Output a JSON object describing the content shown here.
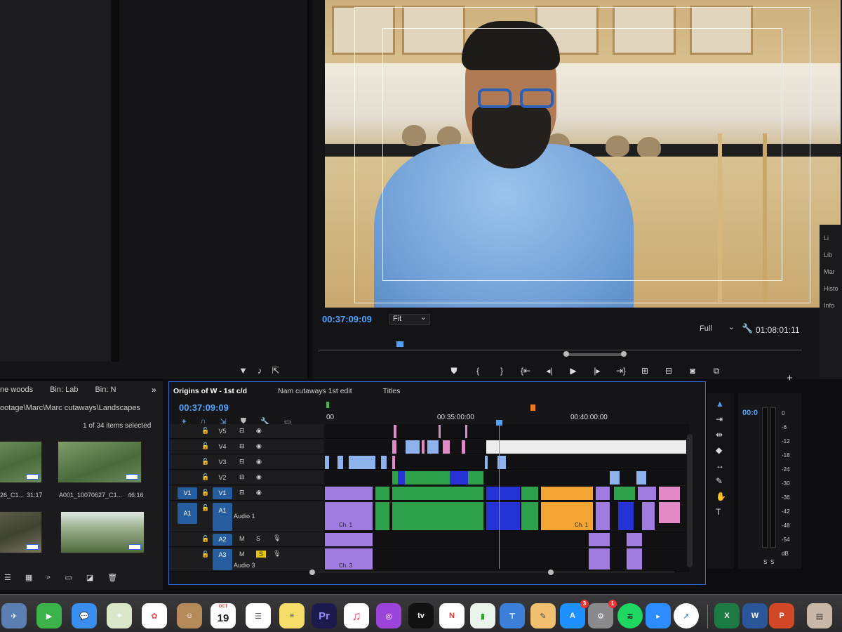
{
  "program": {
    "timecode": "00:37:09:09",
    "zoom": "Fit",
    "resolution": "Full",
    "duration": "01:08:01:11"
  },
  "right_strip": [
    "Li",
    "Lib",
    "Mar",
    "Histo",
    "Info"
  ],
  "project": {
    "tabs": [
      "ne woods",
      "Bin: Lab",
      "Bin: N"
    ],
    "more": "»",
    "path": "ootage\\Marc\\Marc cutaways\\Landscapes",
    "count": "1 of 34 items selected",
    "thumbs": [
      {
        "label": "26_C1...",
        "duration": "31:17"
      },
      {
        "label": "A001_10070627_C1...",
        "duration": "46:16"
      },
      {
        "label": "",
        "duration": ""
      },
      {
        "label": "",
        "duration": ""
      }
    ]
  },
  "timeline": {
    "tabs": [
      "Origins of W - 1st c/d",
      "Nam cutaways 1st edit",
      "Titles"
    ],
    "timecode": "00:37:09:09",
    "ruler": [
      "00",
      "00:35:00:00",
      "00:40:00:00"
    ],
    "tracks": [
      {
        "name": "V5",
        "source": ""
      },
      {
        "name": "V4",
        "source": ""
      },
      {
        "name": "V3",
        "source": ""
      },
      {
        "name": "V2",
        "source": ""
      },
      {
        "name": "V1",
        "source": "V1"
      },
      {
        "name": "A1",
        "source": "A1",
        "label": "Audio 1"
      },
      {
        "name": "A2",
        "source": "",
        "mute": "M",
        "solo": "S"
      },
      {
        "name": "A3",
        "source": "",
        "mute": "M",
        "solo": "S",
        "label": "Audio 3"
      }
    ],
    "clip_labels": [
      "Ch. 1",
      "Ch. 1",
      "Ch. 3"
    ]
  },
  "meter": {
    "timecode": "00:0",
    "db_scale": [
      "0",
      "-6",
      "-12",
      "-18",
      "-24",
      "-30",
      "-36",
      "-42",
      "-48",
      "-54",
      "dB"
    ],
    "solo_labels": [
      "S",
      "S"
    ]
  },
  "dock": {
    "calendar_month": "OCT",
    "calendar_day": "19",
    "premiere_label": "Pr",
    "tv_label": "tv",
    "app_store_badge": "3",
    "prefs_badge": "1"
  },
  "colors": {
    "accent": "#4ea3ff",
    "panel_border": "#2e6ed6",
    "clip_green": "#2ea24a",
    "clip_blue": "#2533d6",
    "clip_purple": "#a07be0",
    "clip_pink": "#e08ac6",
    "clip_orange": "#f3a433"
  }
}
